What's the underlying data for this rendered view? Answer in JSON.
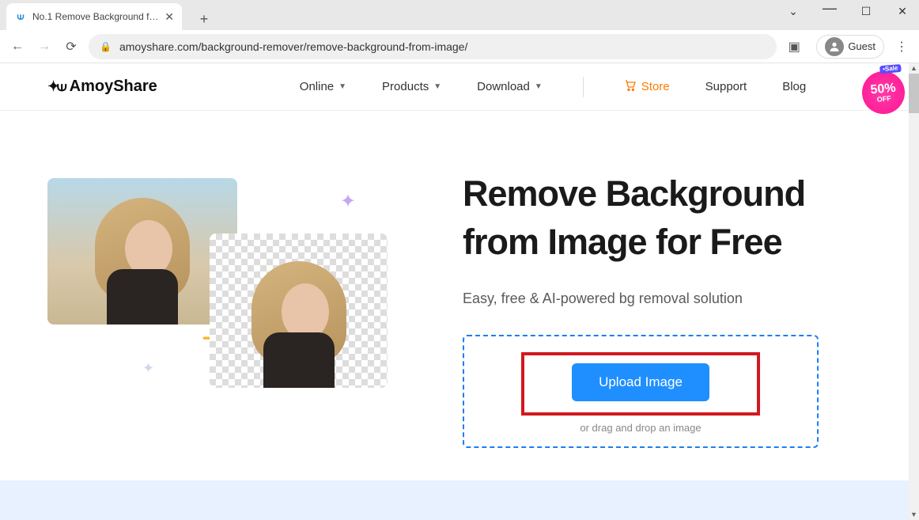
{
  "browser": {
    "tab_title": "No.1 Remove Background from",
    "url": "amoyshare.com/background-remover/remove-background-from-image/",
    "profile_label": "Guest"
  },
  "header": {
    "brand": "AmoyShare",
    "nav": {
      "online": "Online",
      "products": "Products",
      "download": "Download",
      "store": "Store",
      "support": "Support",
      "blog": "Blog"
    },
    "sale": {
      "tag": "•Sale",
      "percent": "50%",
      "off": "OFF"
    }
  },
  "hero": {
    "headline": "Remove Background from Image for Free",
    "subhead": "Easy, free & AI-powered bg removal solution",
    "upload_button": "Upload Image",
    "drag_text": "or drag and drop an image"
  }
}
